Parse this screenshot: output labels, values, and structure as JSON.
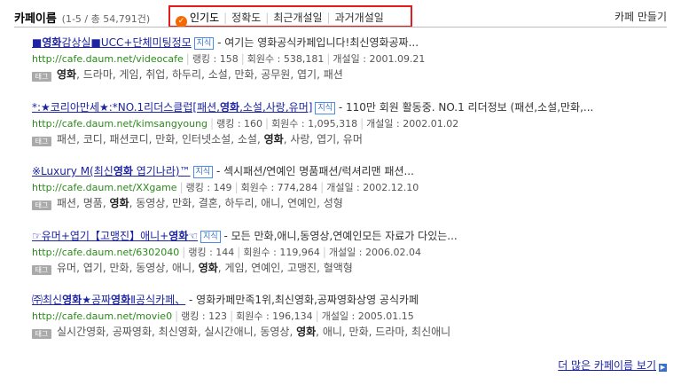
{
  "header": {
    "title": "카페이름",
    "count": "(1-5 / 총 54,791건)",
    "sort_options": [
      "인기도",
      "정확도",
      "최근개설일",
      "과거개설일"
    ],
    "active_sort": "인기도",
    "make_cafe": "카페 만들기"
  },
  "labels": {
    "jisik": "지식",
    "tag": "태그"
  },
  "results": [
    {
      "title_pre": "■",
      "title_hl": "영화",
      "title_post": "감상실■UCC+단체미팅정모",
      "desc": " - 여기는 영화공식카페입니다!최신영화공짜...",
      "url": "http://cafe.daum.net/videocafe",
      "rank": "랭킹 : 158",
      "members": "회원수 : 538,181",
      "opened": "개설일 : 2001.09.21",
      "tags": [
        "영화",
        "드라마",
        "게임",
        "취업",
        "하두리",
        "소설",
        "만화",
        "공무원",
        "엽기",
        "패션"
      ]
    },
    {
      "title_pre": "*:★코리아만세★:*NO.1리더스클럽[패션,",
      "title_hl": "영화",
      "title_post": ",소설,사랑,유머]",
      "desc": " - 110만 회원 활동중. NO.1 리더정보 (패션,소설,만화,...",
      "url": "http://cafe.daum.net/kimsangyoung",
      "rank": "랭킹 : 160",
      "members": "회원수 : 1,095,318",
      "opened": "개설일 : 2002.01.02",
      "tags": [
        "패션",
        "코디",
        "패션코디",
        "만화",
        "인터넷소설",
        "소설",
        "영화",
        "사랑",
        "엽기",
        "유머"
      ]
    },
    {
      "title_pre": "※Luxury M(최신",
      "title_hl": "영화",
      "title_post": " 엽기나라)™",
      "desc": " - 섹시패션/연예인 명품패션/럭셔리맨 패션...",
      "url": "http://cafe.daum.net/XXgame",
      "rank": "랭킹 : 149",
      "members": "회원수 : 774,284",
      "opened": "개설일 : 2002.12.10",
      "tags": [
        "패션",
        "명품",
        "영화",
        "동영상",
        "만화",
        "결혼",
        "하두리",
        "애니",
        "연예인",
        "성형"
      ]
    },
    {
      "title_pre": "☞유머+엽기【고맹진】애니+",
      "title_hl": "영화",
      "title_post": "☜",
      "desc": " - 모든 만화,애니,동영상,연예인모든 자료가 다있는...",
      "url": "http://cafe.daum.net/6302040",
      "rank": "랭킹 : 144",
      "members": "회원수 : 119,964",
      "opened": "개설일 : 2006.02.04",
      "tags": [
        "유머",
        "엽기",
        "만화",
        "동영상",
        "애니",
        "영화",
        "게임",
        "연예인",
        "고맹진",
        "혈액형"
      ]
    },
    {
      "title_pre": "㈜최신",
      "title_hl": "영화",
      "title_mid": "★공짜",
      "title_hl2": "영화",
      "title_post": "Ⅱ공식카페、",
      "desc": " - 영화카페만족1위,최신영화,공짜영화상영 공식카페",
      "url": "http://cafe.daum.net/movie0",
      "rank": "랭킹 : 123",
      "members": "회원수 : 196,134",
      "opened": "개설일 : 2005.01.15",
      "tags": [
        "실시간영화",
        "공짜영화",
        "최신영화",
        "실시간애니",
        "동영상",
        "영화",
        "애니",
        "만화",
        "드라마",
        "최신애니"
      ]
    }
  ],
  "more_link": "더 많은 카페이름 보기"
}
